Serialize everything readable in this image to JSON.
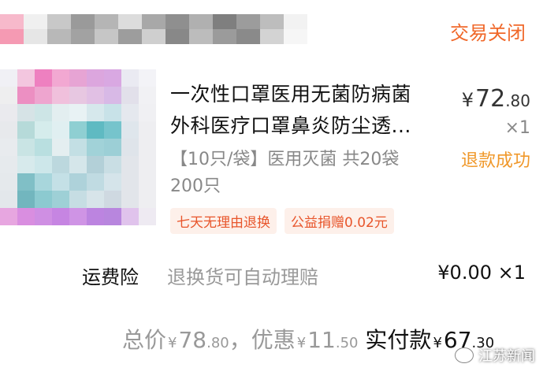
{
  "order": {
    "status": "交易关闭"
  },
  "product": {
    "title_line1": "一次性口罩医用无菌防病菌",
    "title_line2": "外科医疗口罩鼻炎防尘透...",
    "price_currency": "¥",
    "price_int": "72",
    "price_dec": ".80",
    "quantity": "×1",
    "refund_status": "退款成功",
    "spec_line1": "【10只/袋】医用灭菌 共20袋",
    "spec_line2": "200只",
    "tags": [
      "七天无理由退换",
      "公益捐赠0.02元"
    ]
  },
  "insurance": {
    "label": "运费险",
    "desc": "退换货可自动理赔",
    "price": "¥0.00 ×1"
  },
  "summary": {
    "total_label": "总价",
    "total_currency": "¥",
    "total_int": "78",
    "total_dec": ".80",
    "sep": "，",
    "discount_label": "优惠",
    "discount_currency": "¥",
    "discount_int": "11",
    "discount_dec": ".50",
    "pay_label": "实付款",
    "pay_currency": "¥",
    "pay_int": "67",
    "pay_dec": ".30"
  },
  "watermark": {
    "text": "江苏新闻"
  },
  "colors": {
    "accent": "#f0682a",
    "refund": "#f0982a",
    "tag_bg": "#fdf0ea",
    "tag_text": "#e8552b"
  }
}
